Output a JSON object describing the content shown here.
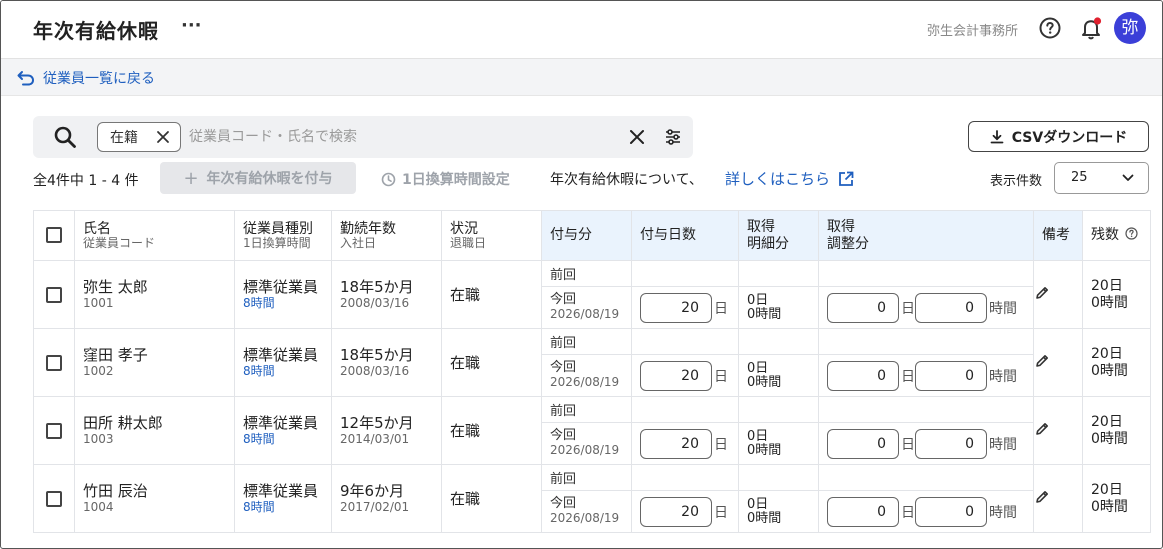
{
  "header": {
    "title": "年次有給休暇",
    "more_label": "···",
    "org_name": "弥生会計事務所",
    "avatar_initial": "弥"
  },
  "nav": {
    "back_label": "従業員一覧に戻る"
  },
  "search": {
    "chip_label": "在籍",
    "placeholder": "従業員コード・氏名で検索",
    "value": ""
  },
  "toolbar": {
    "csv_label": "CSVダウンロード",
    "result_count": "全4件中 1 - 4 件",
    "grant_label": "年次有給休暇を付与",
    "hours_setting_label": "1日換算時間設定",
    "about_text": "年次有給休暇について、",
    "about_link": "詳しくはこちら",
    "per_page_label": "表示件数",
    "per_page_value": "25"
  },
  "table": {
    "headers": {
      "name": "氏名",
      "name_sub": "従業員コード",
      "type": "従業員種別",
      "type_sub": "1日換算時間",
      "tenure": "勤続年数",
      "tenure_sub": "入社日",
      "status": "状況",
      "status_sub": "退職日",
      "grant": "付与分",
      "grant_days": "付与日数",
      "taken_detail_1": "取得",
      "taken_detail_2": "明細分",
      "taken_adj_1": "取得",
      "taken_adj_2": "調整分",
      "note": "備考",
      "remaining": "残数"
    },
    "labels": {
      "prev": "前回",
      "today": "今回",
      "day_unit": "日",
      "hour_unit": "時間"
    },
    "rows": [
      {
        "name": "弥生 太郎",
        "code": "1001",
        "type": "標準従業員",
        "hours": "8時間",
        "tenure": "18年5か月",
        "join_date": "2008/03/16",
        "status": "在職",
        "today_date": "2026/08/19",
        "grant_days": "20",
        "taken_days": "0日",
        "taken_hours": "0時間",
        "adj_days": "0",
        "adj_hours": "0",
        "remaining_days": "20日",
        "remaining_hours": "0時間"
      },
      {
        "name": "窪田 孝子",
        "code": "1002",
        "type": "標準従業員",
        "hours": "8時間",
        "tenure": "18年5か月",
        "join_date": "2008/03/16",
        "status": "在職",
        "today_date": "2026/08/19",
        "grant_days": "20",
        "taken_days": "0日",
        "taken_hours": "0時間",
        "adj_days": "0",
        "adj_hours": "0",
        "remaining_days": "20日",
        "remaining_hours": "0時間"
      },
      {
        "name": "田所 耕太郎",
        "code": "1003",
        "type": "標準従業員",
        "hours": "8時間",
        "tenure": "12年5か月",
        "join_date": "2014/03/01",
        "status": "在職",
        "today_date": "2026/08/19",
        "grant_days": "20",
        "taken_days": "0日",
        "taken_hours": "0時間",
        "adj_days": "0",
        "adj_hours": "0",
        "remaining_days": "20日",
        "remaining_hours": "0時間"
      },
      {
        "name": "竹田 辰治",
        "code": "1004",
        "type": "標準従業員",
        "hours": "8時間",
        "tenure": "9年6か月",
        "join_date": "2017/02/01",
        "status": "在職",
        "today_date": "2026/08/19",
        "grant_days": "20",
        "taken_days": "0日",
        "taken_hours": "0時間",
        "adj_days": "0",
        "adj_hours": "0",
        "remaining_days": "20日",
        "remaining_hours": "0時間"
      }
    ]
  },
  "colors": {
    "accent": "#1f5fbf",
    "avatar_bg": "#3b3fd8",
    "notification_dot": "#e0202e",
    "header_blue_bg": "#eaf3fd"
  }
}
